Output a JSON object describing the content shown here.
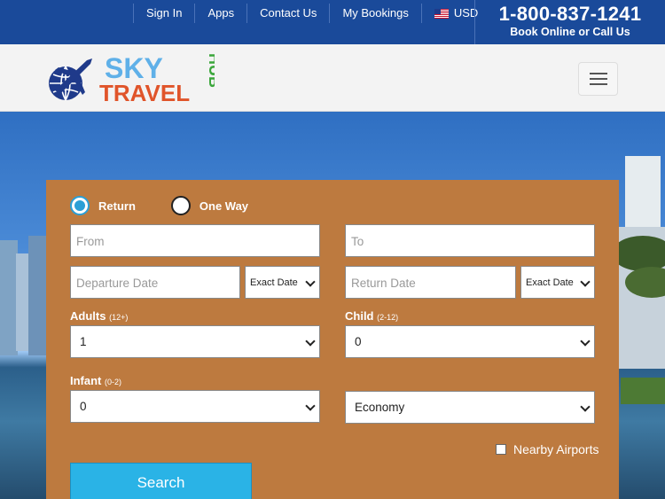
{
  "topnav": {
    "items": [
      "Sign In",
      "Apps",
      "Contact Us",
      "My Bookings"
    ],
    "currency": "USD",
    "currency_icon": "us-flag-icon"
  },
  "contact": {
    "phone": "1-800-837-1241",
    "tagline": "Book Online or Call Us"
  },
  "logo": {
    "word1": "SKY",
    "word2": "TRAVEL",
    "word3": "HUB",
    "colors": {
      "sky": "#5fb0e8",
      "travel": "#e0542a",
      "hub": "#3aa63a",
      "globe": "#1f3a8a"
    }
  },
  "form": {
    "trip_types": [
      {
        "label": "Return",
        "checked": true
      },
      {
        "label": "One Way",
        "checked": false
      }
    ],
    "from_placeholder": "From",
    "to_placeholder": "To",
    "departure_placeholder": "Departure Date",
    "return_placeholder": "Return Date",
    "date_mode_departure": "Exact Date",
    "date_mode_return": "Exact Date",
    "adults_label": "Adults",
    "adults_hint": "(12+)",
    "adults_value": "1",
    "child_label": "Child",
    "child_hint": "(2-12)",
    "child_value": "0",
    "infant_label": "Infant",
    "infant_hint": "(0-2)",
    "infant_value": "0",
    "cabin_value": "Economy",
    "nearby_label": "Nearby Airports",
    "search_label": "Search"
  },
  "colors": {
    "topbar": "#1a4a9a",
    "panel": "#bd7a3f",
    "search_button": "#2ab3e6"
  }
}
